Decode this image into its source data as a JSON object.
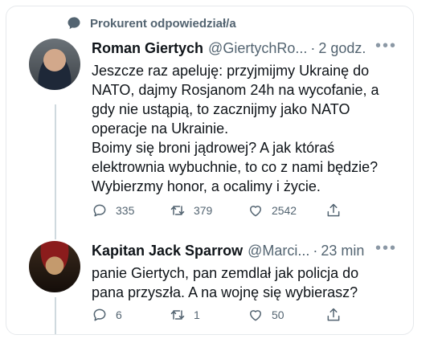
{
  "context": {
    "label": "Prokurent odpowiedział/a"
  },
  "tweets": [
    {
      "author": "Roman Giertych",
      "handle": "@GiertychRo...",
      "time": "2 godz.",
      "lines": [
        "Jeszcze raz apeluję: przyjmijmy Ukrainę do",
        "NATO, dajmy Rosjanom 24h na wycofanie, a",
        "gdy nie ustąpią, to zacznijmy jako NATO",
        "operacje na Ukrainie.",
        "Boimy się broni jądrowej? A jak któraś",
        "elektrownia wybuchnie, to co z nami będzie?",
        "Wybierzmy honor, a ocalimy i życie."
      ],
      "replies": "335",
      "retweets": "379",
      "likes": "2542"
    },
    {
      "author": "Kapitan Jack Sparrow",
      "handle": "@Marci...",
      "time": "23 min",
      "lines": [
        "panie Giertych, pan zemdlał jak policja do",
        "pana przyszła. A na wojnę się wybierasz?"
      ],
      "replies": "6",
      "retweets": "1",
      "likes": "50"
    }
  ],
  "colors": {
    "text": "#0f1419",
    "muted": "#536471",
    "border": "#e6e9ec",
    "line": "#cfd9de"
  },
  "icons": [
    "speech-bubble-icon",
    "reply-icon",
    "retweet-icon",
    "like-icon",
    "share-icon",
    "more-icon"
  ]
}
